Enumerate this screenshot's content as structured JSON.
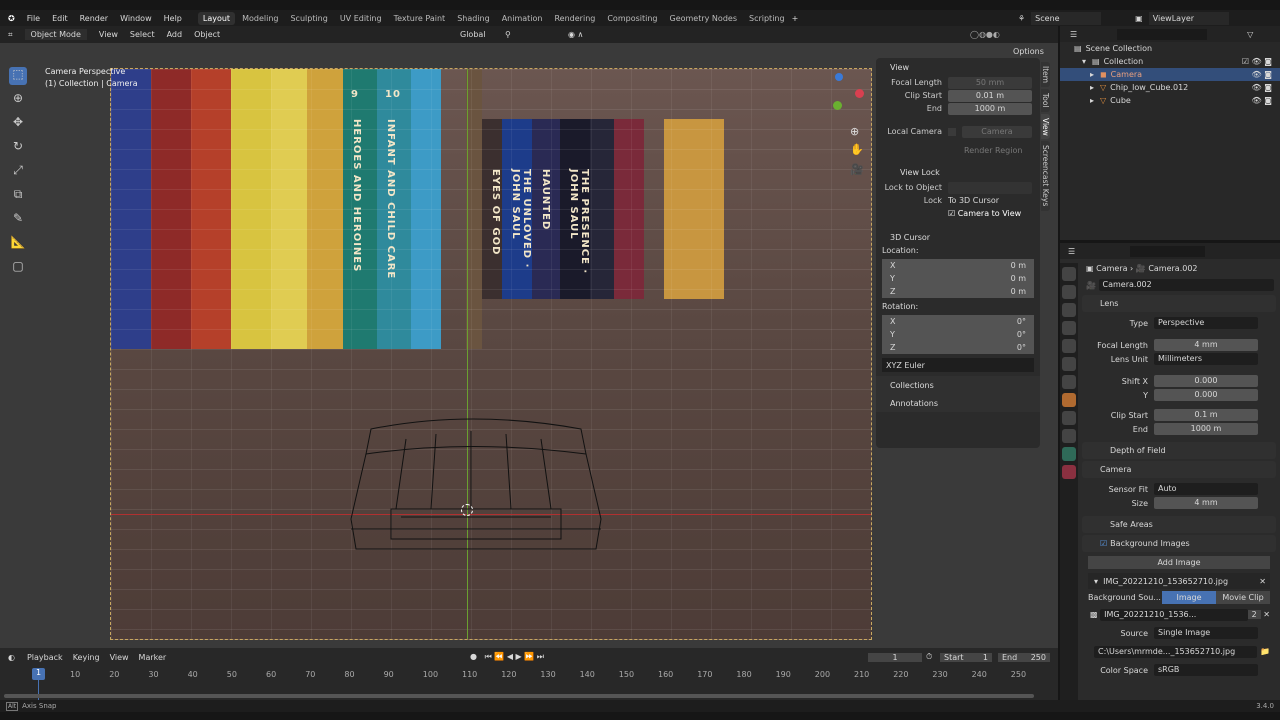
{
  "menu": [
    "File",
    "Edit",
    "Render",
    "Window",
    "Help"
  ],
  "workspaces": [
    "Layout",
    "Modeling",
    "Sculpting",
    "UV Editing",
    "Texture Paint",
    "Shading",
    "Animation",
    "Rendering",
    "Compositing",
    "Geometry Nodes",
    "Scripting"
  ],
  "scene": "Scene",
  "view_layer": "ViewLayer",
  "header": {
    "mode": "Object Mode",
    "items": [
      "View",
      "Select",
      "Add",
      "Object"
    ],
    "transform": "Global",
    "options": "Options"
  },
  "viewport": {
    "title": "Camera Perspective",
    "subtitle": "(1) Collection | Camera",
    "books": [
      {
        "color": "#2e3e8a"
      },
      {
        "color": "#8e2a28"
      },
      {
        "color": "#b5402a"
      },
      {
        "color": "#d8c440"
      },
      {
        "color": "#e0cc52"
      },
      {
        "color": "#cfa23c"
      },
      {
        "color": "#1f7a70",
        "title": "HEROES AND HEROINES",
        "num": "9"
      },
      {
        "color": "#2f8a9c",
        "title": "INFANT AND CHILD CARE",
        "num": "10"
      },
      {
        "color": "#3d9bc6"
      },
      {
        "color": "#6a5440"
      },
      {
        "color": "#3b2f2f",
        "title": "EYES OF GOD"
      },
      {
        "color": "#1d3c8a",
        "title": "THE UNLOVED · JOHN SAUL"
      },
      {
        "color": "#2a2a54",
        "title": "HAUNTED"
      },
      {
        "color": "#1a1a2a",
        "title": "THE PRESENCE · JOHN SAUL"
      },
      {
        "color": "#262638"
      },
      {
        "color": "#7a2a3a"
      },
      {
        "color": "#c89640"
      }
    ]
  },
  "npanel": {
    "view": "View",
    "focal_length": "Focal Length",
    "focal_value": "50 mm",
    "clip_start": "Clip Start",
    "clip_start_value": "0.01 m",
    "end": "End",
    "end_value": "1000 m",
    "local_camera": "Local Camera",
    "camera": "Camera",
    "render_region": "Render Region",
    "view_lock": "View Lock",
    "lock_to_object": "Lock to Object",
    "lock": "Lock",
    "to_3d_cursor": "To 3D Cursor",
    "camera_to_view": "Camera to View",
    "cursor": "3D Cursor",
    "location": "Location:",
    "rotation": "Rotation:",
    "x": "X",
    "y": "Y",
    "z": "Z",
    "loc_val": "0 m",
    "rot_val": "0°",
    "euler": "XYZ Euler",
    "collections": "Collections",
    "annotations": "Annotations",
    "tabs": [
      "Item",
      "Tool",
      "View",
      "Screencast Keys"
    ]
  },
  "outliner": {
    "scene_collection": "Scene Collection",
    "collection": "Collection",
    "items": [
      "Camera",
      "Chip_low_Cube.012",
      "Cube"
    ]
  },
  "properties": {
    "breadcrumb_obj": "Camera",
    "breadcrumb_data": "Camera.002",
    "datablock": "Camera.002",
    "lens": "Lens",
    "type": "Type",
    "type_val": "Perspective",
    "focal": "Focal Length",
    "focal_val": "4 mm",
    "lens_unit": "Lens Unit",
    "lens_unit_val": "Millimeters",
    "shift_x": "Shift X",
    "shift_x_val": "0.000",
    "y": "Y",
    "shift_y_val": "0.000",
    "clip_start": "Clip Start",
    "clip_start_val": "0.1 m",
    "end": "End",
    "end_val": "1000 m",
    "dof": "Depth of Field",
    "camera": "Camera",
    "sensor_fit": "Sensor Fit",
    "sensor_fit_val": "Auto",
    "size": "Size",
    "size_val": "4 mm",
    "safe_areas": "Safe Areas",
    "bg_images": "Background Images",
    "add_image": "Add Image",
    "image_name": "IMG_20221210_153652710.jpg",
    "bg_source": "Background Sou...",
    "image": "Image",
    "movie_clip": "Movie Clip",
    "image_short": "IMG_20221210_1536...",
    "users": "2",
    "source": "Source",
    "source_val": "Single Image",
    "path": "C:\\Users\\mrmde..._153652710.jpg",
    "color_space": "Color Space",
    "color_space_val": "sRGB"
  },
  "timeline": {
    "menus": [
      "Playback",
      "Keying",
      "View",
      "Marker"
    ],
    "current": "1",
    "start_label": "Start",
    "start": "1",
    "end_label": "End",
    "end": "250",
    "ticks": [
      "10",
      "20",
      "30",
      "40",
      "50",
      "60",
      "70",
      "80",
      "90",
      "100",
      "110",
      "120",
      "130",
      "140",
      "150",
      "160",
      "170",
      "180",
      "190",
      "200",
      "210",
      "220",
      "230",
      "240",
      "250"
    ]
  },
  "status": {
    "hint": "Axis Snap",
    "version": "3.4.0"
  }
}
